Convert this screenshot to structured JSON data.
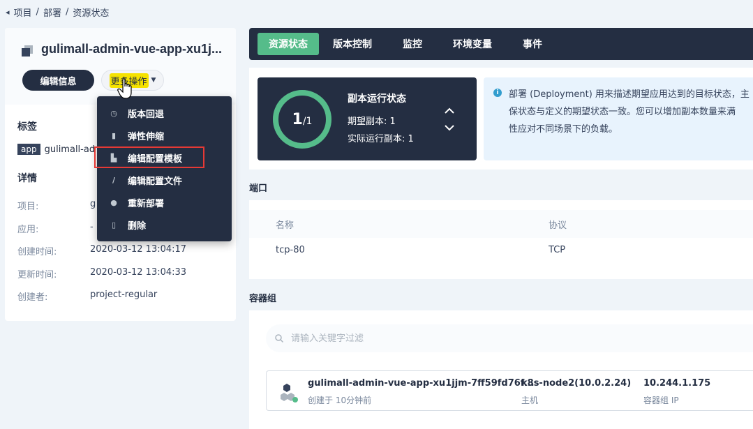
{
  "breadcrumb": {
    "back": "◂",
    "items": [
      "项目",
      "部署",
      "资源状态"
    ],
    "sep": "/"
  },
  "app": {
    "title": "gulimall-admin-vue-app-xu1j...",
    "edit_label": "编辑信息",
    "more_label": "更多操作"
  },
  "labels": {
    "title": "标签",
    "key": "app",
    "value": "gulimall-ad"
  },
  "details": {
    "title": "详情",
    "rows": [
      {
        "label": "项目:",
        "value": "g"
      },
      {
        "label": "应用:",
        "value": "-"
      },
      {
        "label": "创建时间:",
        "value": "2020-03-12 13:04:17"
      },
      {
        "label": "更新时间:",
        "value": "2020-03-12 13:04:33"
      },
      {
        "label": "创建者:",
        "value": "project-regular"
      }
    ]
  },
  "menu": {
    "items": [
      {
        "label": "版本回退",
        "icon": "clock-icon"
      },
      {
        "label": "弹性伸缩",
        "icon": "scale-icon"
      },
      {
        "label": "编辑配置模板",
        "icon": "template-icon"
      },
      {
        "label": "编辑配置文件",
        "icon": "pen-icon"
      },
      {
        "label": "重新部署",
        "icon": "redeploy-icon"
      },
      {
        "label": "删除",
        "icon": "trash-icon"
      }
    ],
    "highlighted_index": 2
  },
  "tabs": [
    {
      "label": "资源状态",
      "active": true
    },
    {
      "label": "版本控制",
      "active": false
    },
    {
      "label": "监控",
      "active": false
    },
    {
      "label": "环境变量",
      "active": false
    },
    {
      "label": "事件",
      "active": false
    }
  ],
  "replica": {
    "ring_current": "1",
    "ring_total": "/1",
    "title": "副本运行状态",
    "desired": "期望副本: 1",
    "actual": "实际运行副本: 1",
    "ratio": 1.0
  },
  "info": {
    "lines": [
      "部署 (Deployment) 用来描述期望应用达到的目标状态，主",
      "保状态与定义的期望状态一致。您可以增加副本数量来满",
      "性应对不同场景下的负载。"
    ]
  },
  "ports": {
    "section": "端口",
    "headers": [
      "名称",
      "协议"
    ],
    "rows": [
      [
        "tcp-80",
        "TCP"
      ]
    ]
  },
  "pods": {
    "section": "容器组",
    "search_placeholder": "请输入关键字过滤",
    "items": [
      {
        "name": "gulimall-admin-vue-app-xu1jjm-7ff59fd76f...",
        "created": "创建于 10分钟前",
        "node": "k8s-node2(10.0.2.24)",
        "node_label": "主机",
        "ip": "10.244.1.175",
        "ip_label": "容器组 IP"
      }
    ]
  },
  "colors": {
    "dark": "#242e42",
    "accent": "#55bc8a",
    "highlight": "#e53935",
    "info_bg": "#e8f3fd"
  }
}
